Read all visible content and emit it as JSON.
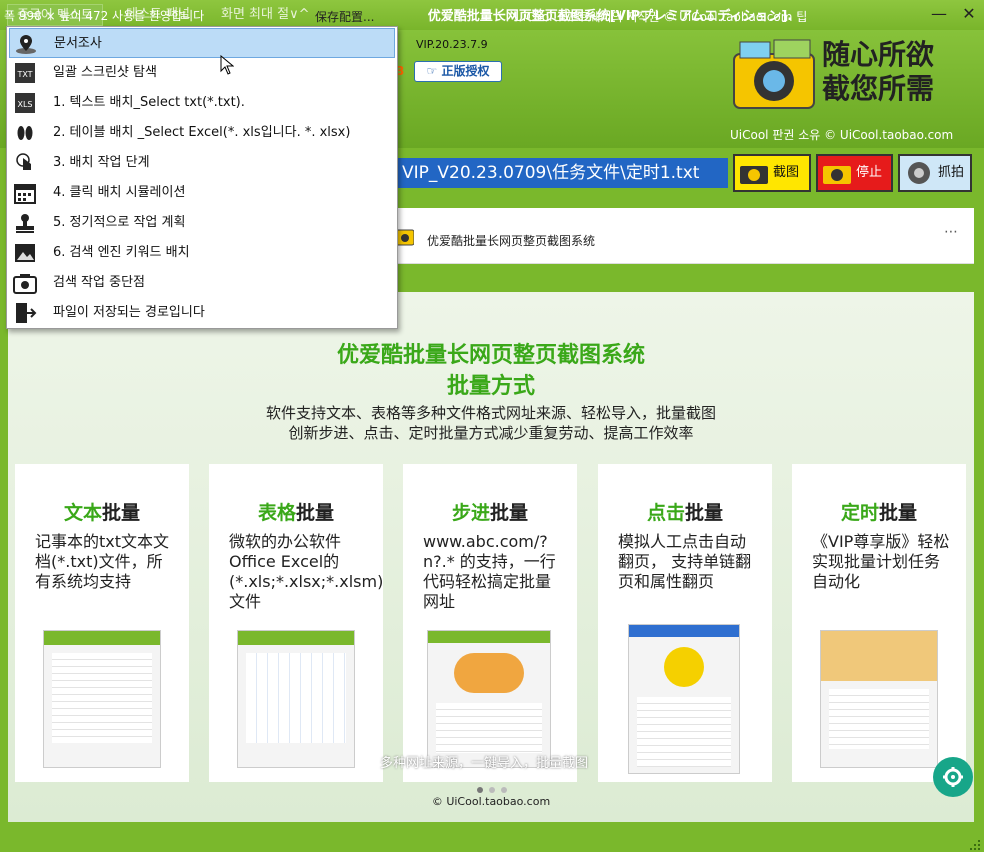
{
  "window": {
    "title": "优爱酷批量长网页整页截图系统[VIPプレミアムエディション].",
    "minimize": "—",
    "close": "✕"
  },
  "tabs": [
    "중국어 텍스트",
    "테스트 패널",
    "화면 최대 절∨^"
  ],
  "header": {
    "version": "VIP.20.23.7.9",
    "number_fragment": "3",
    "auth_button": "正版授权",
    "slogan_line1": "随心所欲",
    "slogan_line2": "截您所需",
    "copyright": "UiCool 판권 소유 © UiCool.taobao.com"
  },
  "pathbar": {
    "value": "VIP_V20.23.0709\\任务文件\\定时1.txt"
  },
  "actions": {
    "shot": "截图",
    "stop": "停止",
    "grab": "抓拍"
  },
  "bar2": {
    "title": "优爱酷批量长网页整页截图系统",
    "more": "⋯"
  },
  "main": {
    "title1": "优爱酷批量长网页整页截图系统",
    "title2": "批量方式",
    "sub1": "软件支持文本、表格等多种文件格式网址来源、轻松导入，批量截图",
    "sub2": "创新步进、点击、定时批量方式减少重复劳动、提高工作效率",
    "cards": [
      {
        "head": "文本",
        "tail": "批量",
        "desc": "记事本的txt文本文档(*.txt)文件，所有系统均支持"
      },
      {
        "head": "表格",
        "tail": "批量",
        "desc": "微软的办公软件Office Excel的(*.xls;*.xlsx;*.xlsm)文件"
      },
      {
        "head": "步进",
        "tail": "批量",
        "desc": "www.abc.com/?n?.* 的支持，一行代码轻松搞定批量网址"
      },
      {
        "head": "点击",
        "tail": "批量",
        "desc": "模拟人工点击自动翻页， 支持单链翻页和属性翻页"
      },
      {
        "head": "定时",
        "tail": "批量",
        "desc": "《VIP尊享版》轻松实现批量计划任务自动化"
      }
    ],
    "banner_caption": "多种网址来源，一键导入，批量截图",
    "banner_copyright": "© UiCool.taobao.com"
  },
  "status": {
    "left": "폭 998 × 높이 472  사용을 환영합니다",
    "mid": "保存配置...",
    "right": "UiCool 소프트웨어의 저작권 © UiCool.taobao.com 팁"
  },
  "menu": {
    "items": [
      {
        "icon": "map-pin-icon",
        "label": "문서조사"
      },
      {
        "icon": "txt-file-icon",
        "label": "일괄 스크린샷 탐색"
      },
      {
        "icon": "xls-file-icon",
        "label": "1. 텍스트 배치_Select txt(*.txt)."
      },
      {
        "icon": "footprints-icon",
        "label": "2. 테이블 배치 _Select Excel(*. xls입니다. *. xlsx)"
      },
      {
        "icon": "touch-hand-icon",
        "label": "3. 배치 작업 단계"
      },
      {
        "icon": "calendar-icon",
        "label": "4. 클릭 배치 시뮬레이션"
      },
      {
        "icon": "stamp-icon",
        "label": "5. 정기적으로 작업 계획"
      },
      {
        "icon": "image-icon",
        "label": "6. 검색 엔진 키워드 배치"
      },
      {
        "icon": "camera-icon",
        "label": "검색 작업 중단점"
      },
      {
        "icon": "exit-door-icon",
        "label": "파일이 저장되는 경로입니다"
      }
    ]
  },
  "colors": {
    "brand_green": "#7ab82c",
    "accent_green": "#3aa819",
    "path_blue": "#2266c4",
    "stop_red": "#e61b1b",
    "shot_yellow": "#ffe600",
    "fab_teal": "#17a689"
  }
}
